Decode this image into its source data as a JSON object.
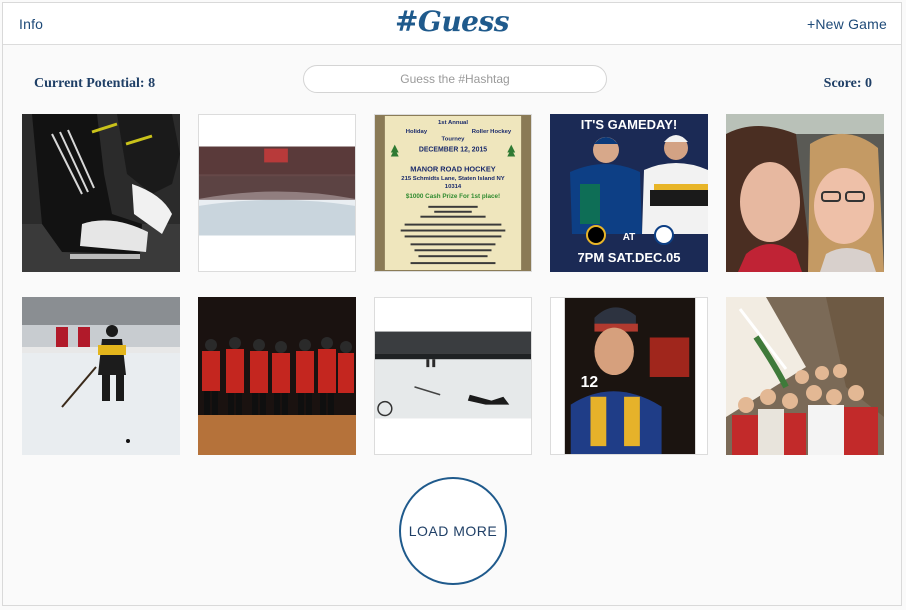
{
  "header": {
    "info_label": "Info",
    "logo_text": "#Guess",
    "new_game_label": "+New Game"
  },
  "status": {
    "potential_label": "Current Potential:",
    "potential_value": "8",
    "score_label": "Score:",
    "score_value": "0"
  },
  "guess": {
    "placeholder": "Guess the #Hashtag"
  },
  "flyer": {
    "line1": "1st Annual",
    "line2": "Holiday",
    "line2b": "Roller Hockey",
    "line3": "Tourney",
    "date": "DECEMBER 12, 2015",
    "venue": "MANOR ROAD HOCKEY",
    "address1": "215 Schmidts Lane, Staten Island NY",
    "zip": "10314",
    "prize": "$1000 Cash Prize For 1st place!"
  },
  "gameday": {
    "headline": "IT'S GAMEDAY!",
    "at": "AT",
    "time": "7PM SAT.DEC.05"
  },
  "load_more_label": "LOAD MORE",
  "colors": {
    "brand": "#1f5a8c",
    "text_dark": "#1f3f66",
    "border": "#dcdcdc"
  }
}
